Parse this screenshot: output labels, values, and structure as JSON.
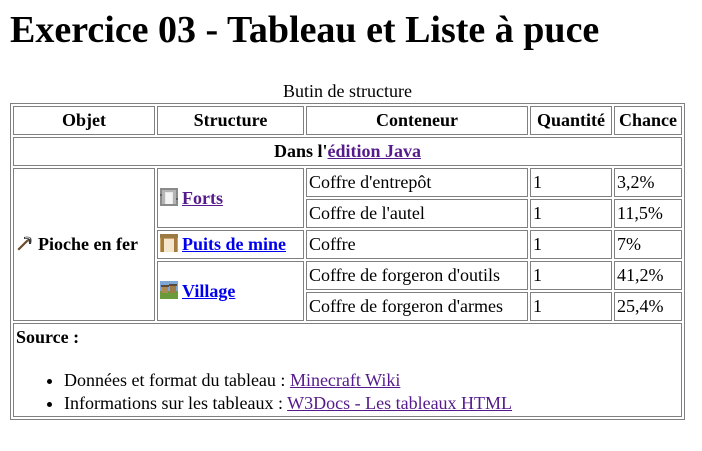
{
  "page": {
    "heading": "Exercice 03 - Tableau et Liste à puce"
  },
  "table": {
    "caption": "Butin de structure",
    "headers": {
      "objet": "Objet",
      "structure": "Structure",
      "conteneur": "Conteneur",
      "quantite": "Quantité",
      "chance": "Chance"
    },
    "edition_row": {
      "prefix": "Dans l'",
      "link": "édition Java"
    },
    "item": {
      "name": "Pioche en fer",
      "icon": "iron-pickaxe-icon"
    },
    "structures": [
      {
        "name": "Forts",
        "icon": "stronghold-icon",
        "rows": [
          {
            "conteneur": "Coffre d'entrepôt",
            "quantite": "1",
            "chance": "3,2%"
          },
          {
            "conteneur": "Coffre de l'autel",
            "quantite": "1",
            "chance": "11,5%"
          }
        ]
      },
      {
        "name": "Puits de mine",
        "icon": "mineshaft-icon",
        "rows": [
          {
            "conteneur": "Coffre",
            "quantite": "1",
            "chance": "7%"
          }
        ]
      },
      {
        "name": "Village",
        "icon": "village-icon",
        "rows": [
          {
            "conteneur": "Coffre de forgeron d'outils",
            "quantite": "1",
            "chance": "41,2%"
          },
          {
            "conteneur": "Coffre de forgeron d'armes",
            "quantite": "1",
            "chance": "25,4%"
          }
        ]
      }
    ],
    "source": {
      "title": "Source :",
      "items": [
        {
          "prefix": "Données et format du tableau : ",
          "link": "Minecraft Wiki"
        },
        {
          "prefix": "Informations sur les tableaux : ",
          "link": "W3Docs - Les tableaux HTML"
        }
      ]
    }
  },
  "colors": {
    "link": "#0000ee",
    "visited_link": "#551a8b",
    "border": "#808080"
  }
}
